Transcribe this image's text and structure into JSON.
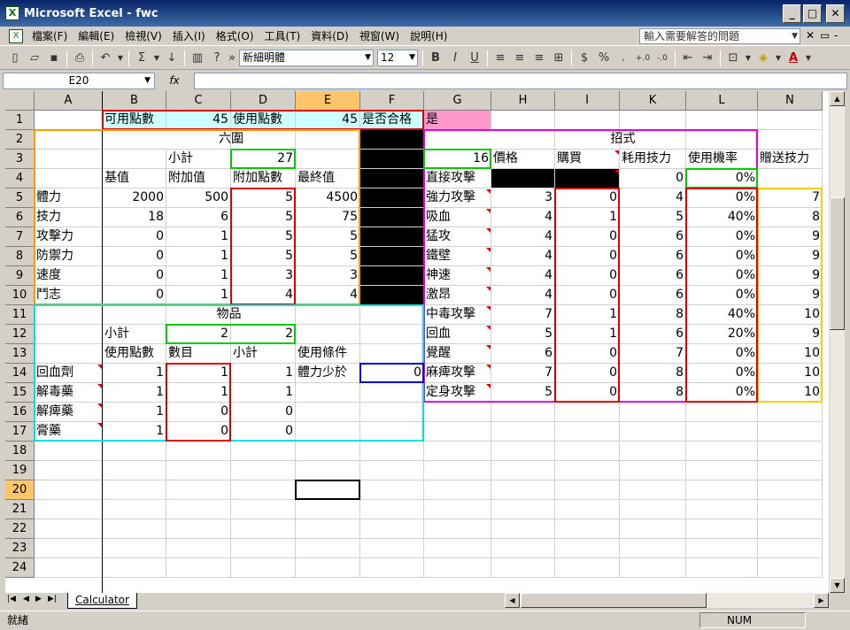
{
  "window": {
    "title": "Microsoft Excel - fwc"
  },
  "menu": {
    "items": [
      "檔案(F)",
      "編輯(E)",
      "檢視(V)",
      "插入(I)",
      "格式(O)",
      "工具(T)",
      "資料(D)",
      "視窗(W)",
      "說明(H)"
    ],
    "help_placeholder": "輸入需要解答的問題"
  },
  "toolbar": {
    "font": "新細明體",
    "size": "12"
  },
  "formula": {
    "cell_ref": "E20",
    "fx": "fx",
    "content": ""
  },
  "columns": [
    "A",
    "B",
    "C",
    "D",
    "E",
    "F",
    "G",
    "H",
    "I",
    "K",
    "L",
    "N"
  ],
  "rows": [
    "1",
    "2",
    "3",
    "4",
    "5",
    "6",
    "7",
    "8",
    "9",
    "10",
    "11",
    "12",
    "13",
    "14",
    "15",
    "16",
    "17",
    "18",
    "19",
    "20",
    "21",
    "22",
    "23",
    "24"
  ],
  "cells": {
    "B1": "可用點數",
    "C1": "45",
    "D1": "使用點數",
    "E1": "45",
    "F1": "是否合格",
    "G1": "是",
    "B2": "六圍",
    "G2": "招式",
    "C3": "小計",
    "D3": "27",
    "G3": "16",
    "H3": "價格",
    "I3": "購買",
    "K3": "耗用技力",
    "L3": "使用機率",
    "N3": "贈送技力",
    "B4": "基值",
    "C4": "附加值",
    "D4": "附加點數",
    "E4": "最終值",
    "G4": "直接攻擊",
    "K4": "0",
    "L4": "0%",
    "A5": "體力",
    "B5": "2000",
    "C5": "500",
    "D5": "5",
    "E5": "4500",
    "G5": "強力攻擊",
    "H5": "3",
    "I5": "0",
    "K5": "4",
    "L5": "0%",
    "N5": "7",
    "A6": "技力",
    "B6": "18",
    "C6": "6",
    "D6": "5",
    "E6": "75",
    "G6": "吸血",
    "H6": "4",
    "I6": "1",
    "K6": "5",
    "L6": "40%",
    "N6": "8",
    "A7": "攻擊力",
    "B7": "0",
    "C7": "1",
    "D7": "5",
    "E7": "5",
    "G7": "猛攻",
    "H7": "4",
    "I7": "0",
    "K7": "6",
    "L7": "0%",
    "N7": "9",
    "A8": "防禦力",
    "B8": "0",
    "C8": "1",
    "D8": "5",
    "E8": "5",
    "G8": "鐵壁",
    "H8": "4",
    "I8": "0",
    "K8": "6",
    "L8": "0%",
    "N8": "9",
    "A9": "速度",
    "B9": "0",
    "C9": "1",
    "D9": "3",
    "E9": "3",
    "G9": "神速",
    "H9": "4",
    "I9": "0",
    "K9": "6",
    "L9": "0%",
    "N9": "9",
    "A10": "鬥志",
    "B10": "0",
    "C10": "1",
    "D10": "4",
    "E10": "4",
    "G10": "激昂",
    "H10": "4",
    "I10": "0",
    "K10": "6",
    "L10": "0%",
    "N10": "9",
    "A11": "物品",
    "G11": "中毒攻擊",
    "H11": "7",
    "I11": "1",
    "K11": "8",
    "L11": "40%",
    "N11": "10",
    "B12": "小計",
    "C12": "2",
    "D12": "2",
    "G12": "回血",
    "H12": "5",
    "I12": "1",
    "K12": "6",
    "L12": "20%",
    "N12": "9",
    "B13": "使用點數",
    "C13": "數目",
    "D13": "小計",
    "E13": "使用條件",
    "G13": "覺醒",
    "H13": "6",
    "I13": "0",
    "K13": "7",
    "L13": "0%",
    "N13": "10",
    "A14": "回血劑",
    "B14": "1",
    "C14": "1",
    "D14": "1",
    "E14": "體力少於",
    "F14": "0",
    "G14": "麻痺攻擊",
    "H14": "7",
    "I14": "0",
    "K14": "8",
    "L14": "0%",
    "N14": "10",
    "A15": "解毒藥",
    "B15": "1",
    "C15": "1",
    "D15": "1",
    "G15": "定身攻擊",
    "H15": "5",
    "I15": "0",
    "K15": "8",
    "L15": "0%",
    "N15": "10",
    "A16": "解痺藥",
    "B16": "1",
    "C16": "0",
    "D16": "0",
    "A17": "膏藥",
    "B17": "1",
    "C17": "0",
    "D17": "0"
  },
  "sheet_tab": "Calculator",
  "status": {
    "left": "就緒",
    "num": "NUM"
  },
  "colors": {
    "title_bar": "#0a246a",
    "active_header": "#ffc56b",
    "cyan_fill": "#ccffff",
    "pink_fill": "#ff99cc"
  }
}
